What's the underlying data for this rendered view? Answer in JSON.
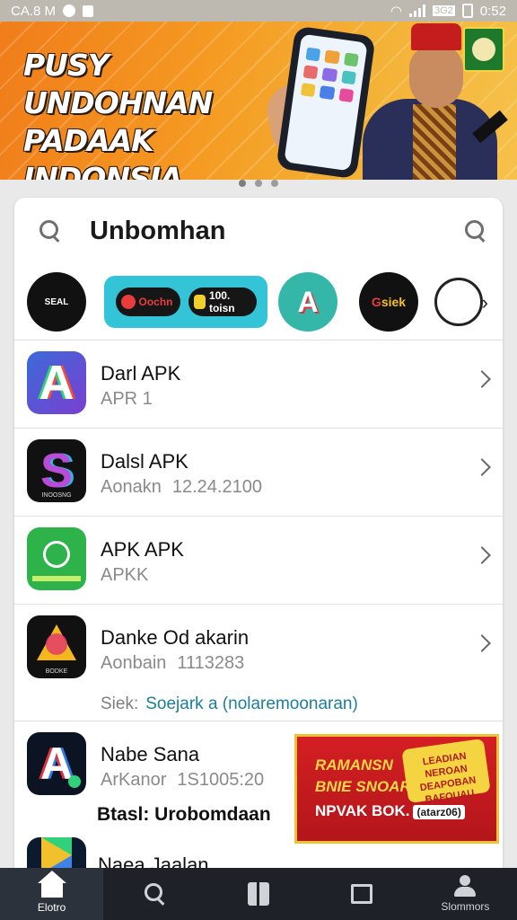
{
  "status_bar": {
    "time_left": "CA.8 M",
    "time_right": "0:52",
    "net_label": "3G2"
  },
  "banner": {
    "headline_line1": "PUSY UNDOHNAN",
    "headline_line2": "PADAAK INDONSIA"
  },
  "carousel": {
    "pages": 3,
    "active": 0
  },
  "search": {
    "query": "Unbomhan"
  },
  "categories": [
    {
      "name": "logo-1",
      "label": "SEAL"
    },
    {
      "name": "Ooohn",
      "label": "Oochn"
    },
    {
      "name": "1000-tosin",
      "label": "100. toisn"
    },
    {
      "name": "A",
      "label": "A"
    },
    {
      "name": "Gsiek",
      "label": "Gsiek"
    }
  ],
  "apps": [
    {
      "name": "Darl APK",
      "sub": "APR 1",
      "value": ""
    },
    {
      "name": "Dalsl APK",
      "sub": "Aonakn",
      "value": "12.24.2100",
      "icon_caption": "INOOSNG"
    },
    {
      "name": "APK APK",
      "sub": "APKK",
      "value": ""
    },
    {
      "name": "Danke Od akarin",
      "sub": "Aonbain",
      "value": "1113283",
      "extra_label": "Siek:",
      "extra_link": "Soejark a (nolaremoonaran)",
      "icon_caption": "BODKE"
    },
    {
      "name": "Nabe Sana",
      "sub": "ArKanor",
      "value": "1S1005:20",
      "highlight": "Btasl: Urobomdaan"
    }
  ],
  "ad": {
    "line1": "RAMANSN",
    "line2": "BNIE SNOAR",
    "line3": "NPVAK BOK.",
    "tag": "(atarz06)",
    "badge_text": "LEADIAN NEROAN DEAPOBAN BAFOUAU"
  },
  "peek_item": {
    "name": "Naea Jaalan"
  },
  "nav": [
    {
      "label": "Elotro",
      "icon": "home-icon",
      "active": true
    },
    {
      "label": "",
      "icon": "search-icon",
      "active": false
    },
    {
      "label": "",
      "icon": "box-icon",
      "active": false
    },
    {
      "label": "",
      "icon": "square-icon",
      "active": false
    },
    {
      "label": "Slommors",
      "icon": "profile-icon",
      "active": false
    }
  ]
}
